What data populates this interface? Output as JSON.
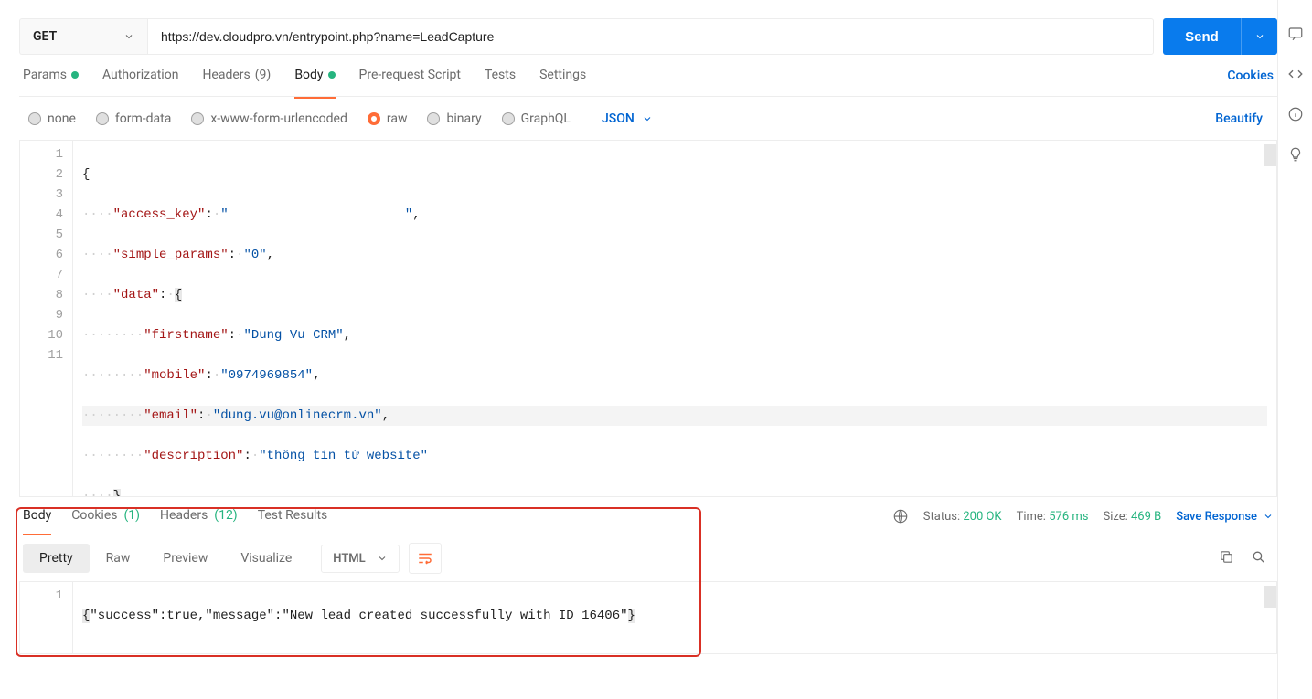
{
  "request": {
    "method": "GET",
    "url": "https://dev.cloudpro.vn/entrypoint.php?name=LeadCapture",
    "send_label": "Send"
  },
  "req_tabs": {
    "params": "Params",
    "authorization": "Authorization",
    "headers": "Headers",
    "headers_count": "(9)",
    "body": "Body",
    "prerequest": "Pre-request Script",
    "tests": "Tests",
    "settings": "Settings",
    "cookies": "Cookies"
  },
  "body_types": {
    "none": "none",
    "formdata": "form-data",
    "xwww": "x-www-form-urlencoded",
    "raw": "raw",
    "binary": "binary",
    "graphql": "GraphQL",
    "lang": "JSON",
    "beautify": "Beautify"
  },
  "request_body_lines": [
    "{",
    "\"access_key\": \"                       \",",
    "\"simple_params\": \"0\",",
    "\"data\": {",
    "\"firstname\": \"Dung Vu CRM\",",
    "\"mobile\": \"0974969854\",",
    "\"email\": \"dung.vu@onlinecrm.vn\",",
    "\"description\": \"thông tin từ website\"",
    "}",
    "}",
    ""
  ],
  "resp_tabs": {
    "body": "Body",
    "cookies": "Cookies",
    "cookies_count": "(1)",
    "headers": "Headers",
    "headers_count": "(12)",
    "testresults": "Test Results"
  },
  "status": {
    "status_label": "Status:",
    "status_value": "200 OK",
    "time_label": "Time:",
    "time_value": "576 ms",
    "size_label": "Size:",
    "size_value": "469 B",
    "save_response": "Save Response"
  },
  "resp_views": {
    "pretty": "Pretty",
    "raw": "Raw",
    "preview": "Preview",
    "visualize": "Visualize",
    "format": "HTML"
  },
  "response_body": {
    "line1": "{\"success\":true,\"message\":\"New lead created successfully with ID 16406\"}"
  }
}
